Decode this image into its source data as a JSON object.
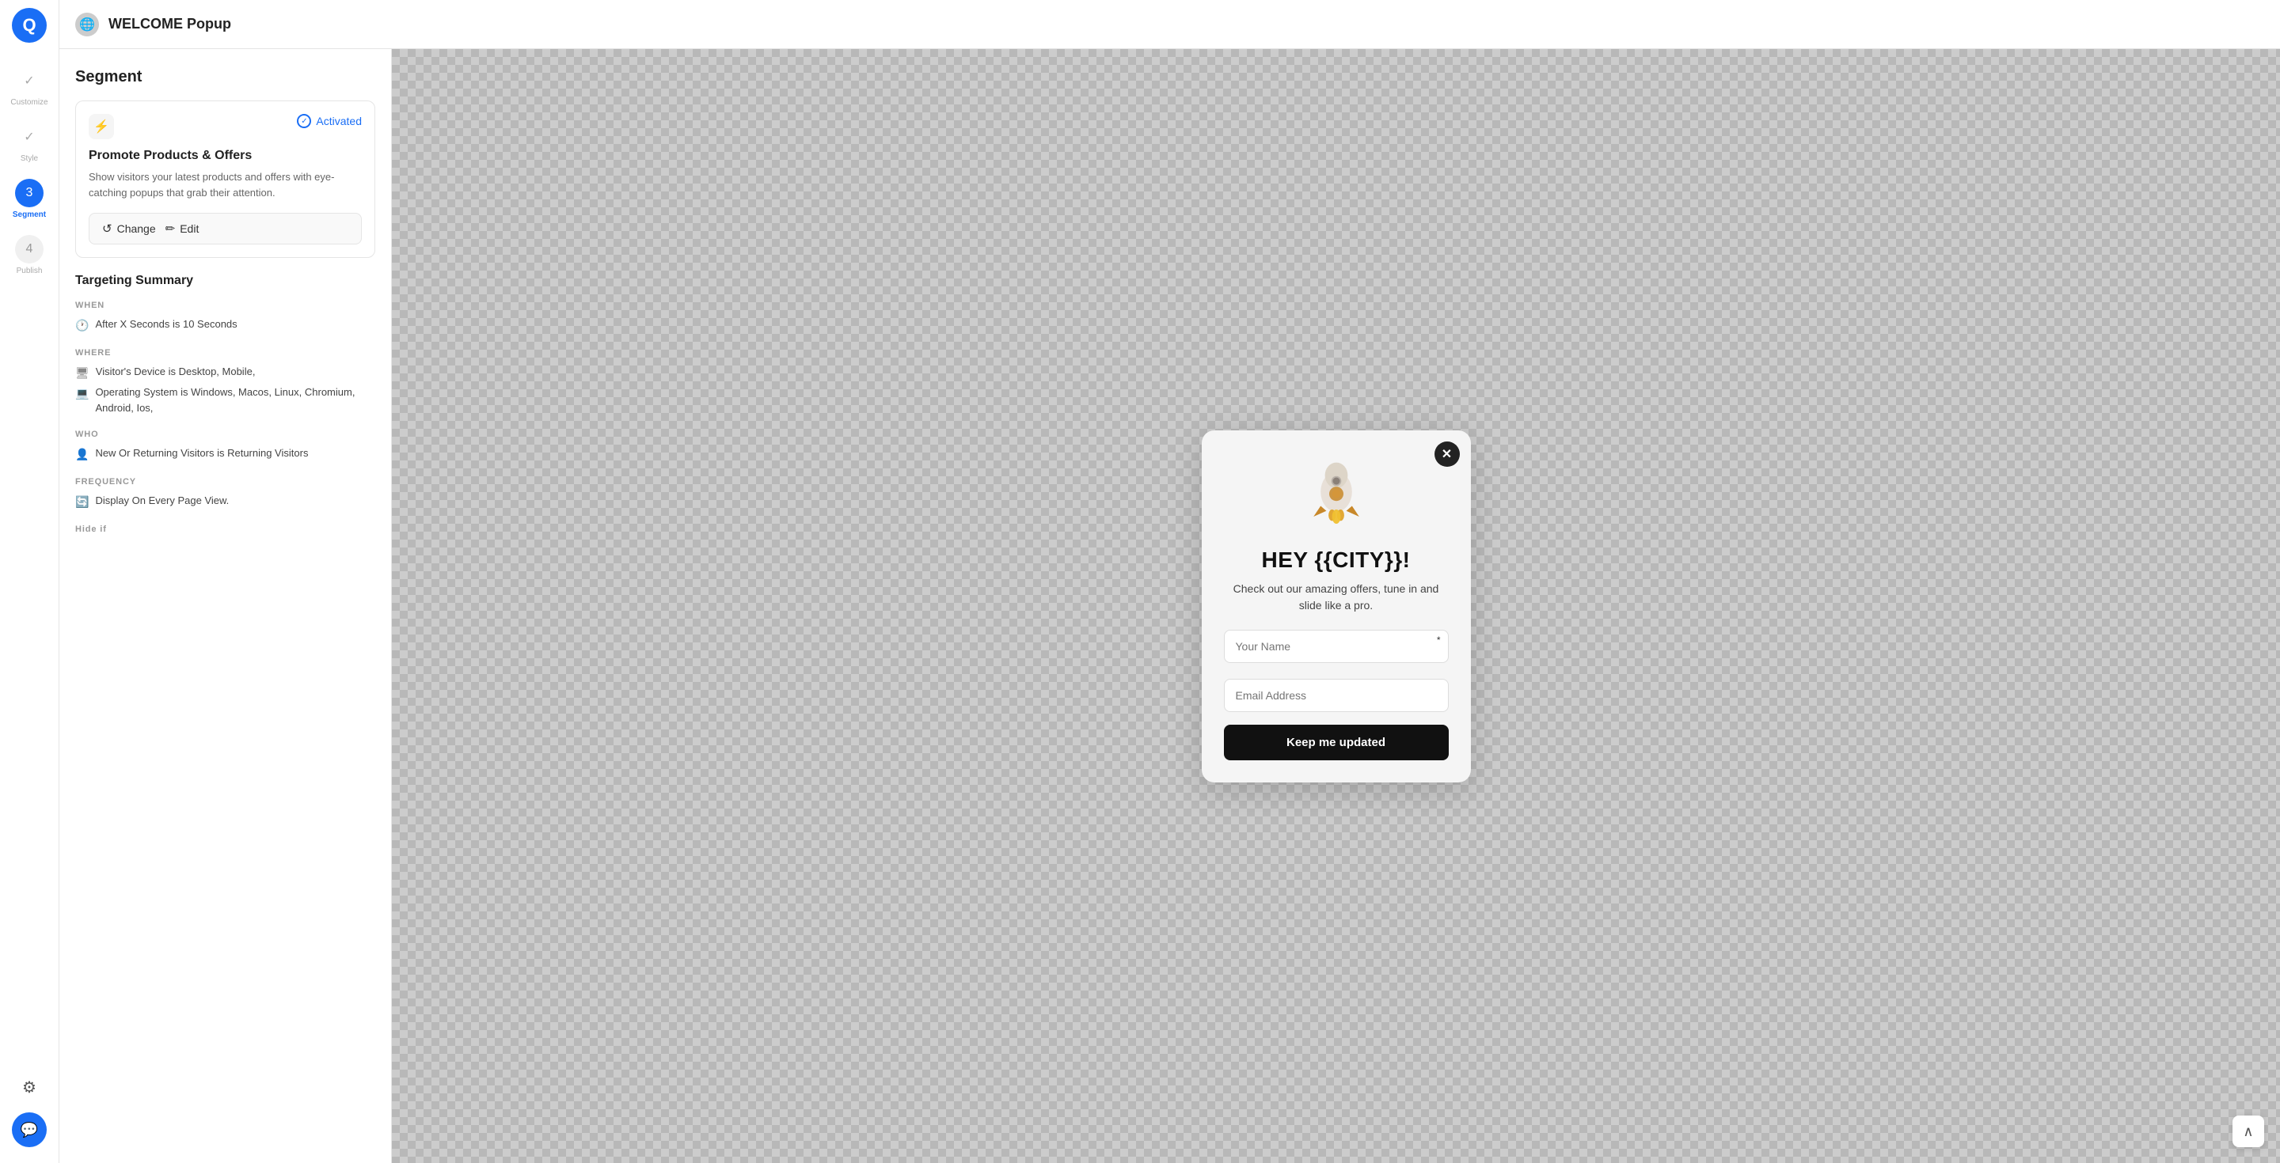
{
  "app": {
    "logo_text": "Q",
    "title": "WELCOME Popup"
  },
  "sidebar": {
    "items": [
      {
        "id": "customize",
        "label": "Customize",
        "step": null,
        "icon": "check",
        "active": false
      },
      {
        "id": "style",
        "label": "Style",
        "step": null,
        "icon": "check",
        "active": false
      },
      {
        "id": "segment",
        "label": "Segment",
        "step": "3",
        "icon": "3",
        "active": true
      },
      {
        "id": "publish",
        "label": "Publish",
        "step": "4",
        "icon": "4",
        "active": false
      }
    ]
  },
  "left_panel": {
    "title": "Segment",
    "card": {
      "title": "Promote Products & Offers",
      "description": "Show visitors your latest products and offers with eye-catching popups that grab their attention.",
      "activated_label": "Activated",
      "change_label": "Change",
      "edit_label": "Edit"
    },
    "targeting": {
      "title": "Targeting Summary",
      "when_label": "WHEN",
      "when_items": [
        {
          "text": "After X Seconds is 10 Seconds"
        }
      ],
      "where_label": "WHERE",
      "where_items": [
        {
          "text": "Visitor's Device is Desktop, Mobile,"
        },
        {
          "text": "Operating System is Windows, Macos, Linux, Chromium, Android, Ios,"
        }
      ],
      "who_label": "WHO",
      "who_items": [
        {
          "text": "New Or Returning Visitors is Returning Visitors"
        }
      ],
      "frequency_label": "FREQUENCY",
      "frequency_items": [
        {
          "text": "Display On Every Page View."
        }
      ],
      "hide_if_label": "Hide if"
    }
  },
  "popup": {
    "headline": "HEY {{CITY}}!",
    "subtext": "Check out our amazing offers, tune in and slide like a pro.",
    "name_placeholder": "Your Name",
    "email_placeholder": "Email Address",
    "button_label": "Keep me updated",
    "close_icon": "✕"
  },
  "bottom_controls": {
    "scroll_up_icon": "∧"
  }
}
